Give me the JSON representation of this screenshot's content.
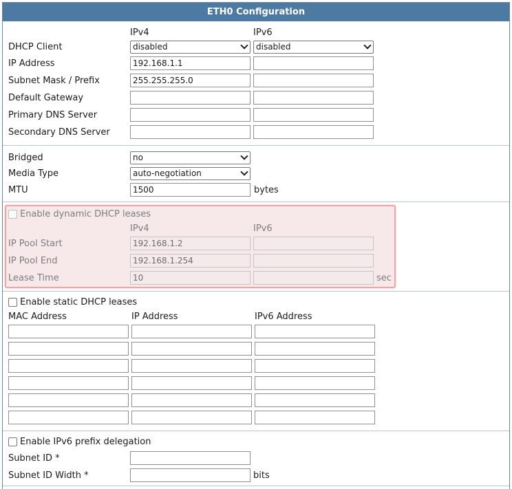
{
  "title": "ETH0 Configuration",
  "ip_section": {
    "col_ipv4": "IPv4",
    "col_ipv6": "IPv6",
    "dhcp_client": {
      "label": "DHCP Client",
      "ipv4": "disabled",
      "ipv6": "disabled"
    },
    "ip_address": {
      "label": "IP Address",
      "ipv4": "192.168.1.1",
      "ipv6": ""
    },
    "subnet_mask": {
      "label": "Subnet Mask / Prefix",
      "ipv4": "255.255.255.0",
      "ipv6": ""
    },
    "default_gateway": {
      "label": "Default Gateway",
      "ipv4": "",
      "ipv6": ""
    },
    "primary_dns": {
      "label": "Primary DNS Server",
      "ipv4": "",
      "ipv6": ""
    },
    "secondary_dns": {
      "label": "Secondary DNS Server",
      "ipv4": "",
      "ipv6": ""
    }
  },
  "link_section": {
    "bridged": {
      "label": "Bridged",
      "value": "no"
    },
    "media_type": {
      "label": "Media Type",
      "value": "auto-negotiation"
    },
    "mtu": {
      "label": "MTU",
      "value": "1500",
      "unit": "bytes"
    }
  },
  "dynamic_dhcp": {
    "checkbox_label": "Enable dynamic DHCP leases",
    "checked": false,
    "col_ipv4": "IPv4",
    "col_ipv6": "IPv6",
    "pool_start": {
      "label": "IP Pool Start",
      "ipv4": "192.168.1.2",
      "ipv6": ""
    },
    "pool_end": {
      "label": "IP Pool End",
      "ipv4": "192.168.1.254",
      "ipv6": ""
    },
    "lease_time": {
      "label": "Lease Time",
      "ipv4": "10",
      "ipv6": "",
      "unit": "sec"
    },
    "highlight_color": "#f0a4a4"
  },
  "static_dhcp": {
    "checkbox_label": "Enable static DHCP leases",
    "checked": false,
    "col_mac": "MAC Address",
    "col_ip": "IP Address",
    "col_ipv6": "IPv6 Address",
    "rows": [
      {
        "mac": "",
        "ip": "",
        "ipv6": ""
      },
      {
        "mac": "",
        "ip": "",
        "ipv6": ""
      },
      {
        "mac": "",
        "ip": "",
        "ipv6": ""
      },
      {
        "mac": "",
        "ip": "",
        "ipv6": ""
      },
      {
        "mac": "",
        "ip": "",
        "ipv6": ""
      },
      {
        "mac": "",
        "ip": "",
        "ipv6": ""
      }
    ]
  },
  "prefix_delegation": {
    "checkbox_label": "Enable IPv6 prefix delegation",
    "checked": false,
    "subnet_id": {
      "label": "Subnet ID *",
      "value": ""
    },
    "subnet_id_width": {
      "label": "Subnet ID Width *",
      "value": "",
      "unit": "bits"
    }
  },
  "colors": {
    "header_bg": "#4d7aa3",
    "header_text": "#ffffff",
    "border": "#6b8296"
  }
}
